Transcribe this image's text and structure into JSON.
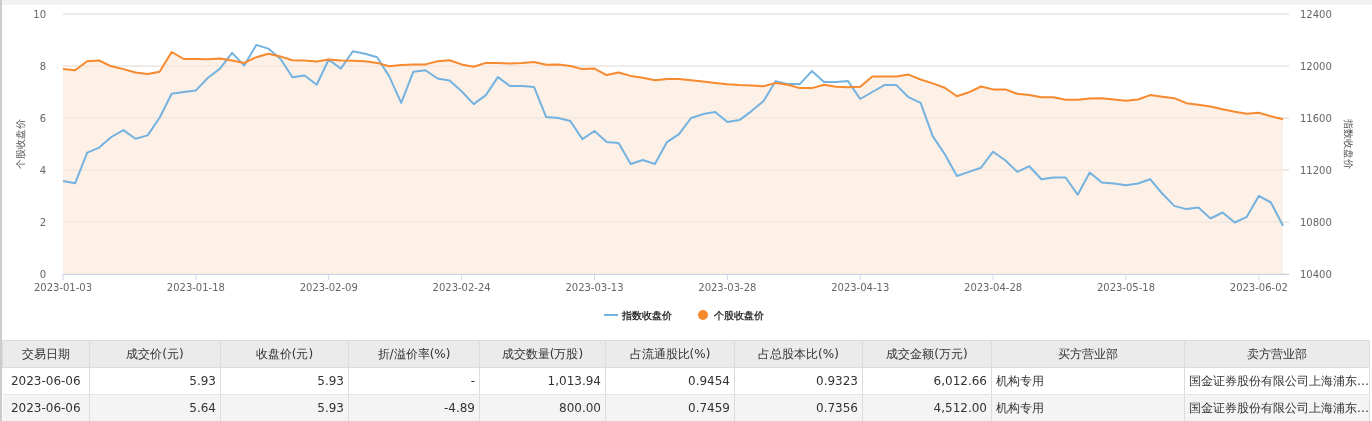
{
  "chart": {
    "chart_data": {
      "type": "line",
      "grid": true,
      "legend": "bottom",
      "ylabel": "个股收盘价",
      "y2label": "指数收盘价",
      "ylim": [
        0,
        10
      ],
      "yticks": [
        0,
        2,
        4,
        6,
        8,
        10
      ],
      "y2lim": [
        10400,
        12400
      ],
      "y2ticks": [
        10400,
        10800,
        11200,
        11600,
        12000,
        12400
      ],
      "categories": [
        "2023-01-03",
        null,
        null,
        null,
        null,
        null,
        null,
        null,
        null,
        null,
        null,
        "2023-01-18",
        null,
        null,
        null,
        null,
        null,
        null,
        null,
        null,
        null,
        null,
        "2023-02-09",
        null,
        null,
        null,
        null,
        null,
        null,
        null,
        null,
        null,
        null,
        "2023-02-24",
        null,
        null,
        null,
        null,
        null,
        null,
        null,
        null,
        null,
        null,
        "2023-03-13",
        null,
        null,
        null,
        null,
        null,
        null,
        null,
        null,
        null,
        null,
        "2023-03-28",
        null,
        null,
        null,
        null,
        null,
        null,
        null,
        null,
        null,
        null,
        "2023-04-13",
        null,
        null,
        null,
        null,
        null,
        null,
        null,
        null,
        null,
        null,
        "2023-04-28",
        null,
        null,
        null,
        null,
        null,
        null,
        null,
        null,
        null,
        null,
        "2023-05-18",
        null,
        null,
        null,
        null,
        null,
        null,
        null,
        null,
        null,
        null,
        "2023-06-02",
        null,
        null
      ],
      "series": [
        {
          "name": "指数收盘价",
          "color": "#74b2e0",
          "type": "line",
          "axis": "y2",
          "values": [
            11116,
            11098,
            11334,
            11372,
            11454,
            11507,
            11441,
            11466,
            11602,
            11786,
            11801,
            11812,
            11909,
            11980,
            12101,
            12003,
            12162,
            12134,
            12055,
            11914,
            11927,
            11855,
            12050,
            11980,
            12113,
            12095,
            12067,
            11922,
            11717,
            11955,
            11968,
            11904,
            11889,
            11806,
            11707,
            11776,
            11915,
            11846,
            11846,
            11838,
            11607,
            11600,
            11577,
            11438,
            11500,
            11415,
            11407,
            11246,
            11277,
            11246,
            11415,
            11476,
            11600,
            11630,
            11646,
            11569,
            11584,
            11653,
            11730,
            11884,
            11861,
            11861,
            11961,
            11876,
            11876,
            11884,
            11746,
            11800,
            11853,
            11853,
            11760,
            11717,
            11461,
            11321,
            11154,
            11185,
            11218,
            11341,
            11275,
            11185,
            11229,
            11129,
            11142,
            11142,
            11009,
            11180,
            11103,
            11096,
            11083,
            11096,
            11129,
            11019,
            10924,
            10899,
            10911,
            10827,
            10873,
            10796,
            10840,
            11001,
            10950,
            10771
          ]
        },
        {
          "name": "个股收盘价",
          "color": "#f7892e",
          "type": "area",
          "values": [
            7.89,
            7.84,
            8.18,
            8.21,
            7.99,
            7.88,
            7.75,
            7.69,
            7.78,
            8.54,
            8.27,
            8.27,
            8.26,
            8.29,
            8.21,
            8.12,
            8.34,
            8.47,
            8.37,
            8.22,
            8.21,
            8.17,
            8.25,
            8.21,
            8.2,
            8.18,
            8.12,
            7.99,
            8.04,
            8.06,
            8.06,
            8.18,
            8.22,
            8.06,
            7.97,
            8.12,
            8.12,
            8.1,
            8.12,
            8.15,
            8.05,
            8.06,
            8.0,
            7.88,
            7.9,
            7.65,
            7.75,
            7.62,
            7.55,
            7.45,
            7.5,
            7.5,
            7.45,
            7.4,
            7.35,
            7.3,
            7.27,
            7.25,
            7.22,
            7.35,
            7.28,
            7.15,
            7.15,
            7.28,
            7.2,
            7.18,
            7.2,
            7.6,
            7.6,
            7.6,
            7.67,
            7.48,
            7.33,
            7.16,
            6.84,
            6.99,
            7.21,
            7.1,
            7.1,
            6.93,
            6.88,
            6.8,
            6.8,
            6.7,
            6.7,
            6.75,
            6.76,
            6.71,
            6.66,
            6.71,
            6.88,
            6.82,
            6.76,
            6.57,
            6.51,
            6.44,
            6.34,
            6.24,
            6.16,
            6.2,
            6.07,
            5.95
          ]
        }
      ]
    }
  },
  "table": {
    "columns": [
      "交易日期",
      "成交价(元)",
      "收盘价(元)",
      "折/溢价率(%)",
      "成交数量(万股)",
      "占流通股比(%)",
      "占总股本比(%)",
      "成交金额(万元)",
      "买方营业部",
      "卖方营业部"
    ],
    "rows": [
      [
        "2023-06-06",
        "5.93",
        "5.93",
        "-",
        "1,013.94",
        "0.9454",
        "0.9323",
        "6,012.66",
        "机构专用",
        "国金证券股份有限公司上海浦东…"
      ],
      [
        "2023-06-06",
        "5.64",
        "5.93",
        "-4.89",
        "800.00",
        "0.7459",
        "0.7356",
        "4,512.00",
        "机构专用",
        "国金证券股份有限公司上海浦东…"
      ]
    ]
  }
}
